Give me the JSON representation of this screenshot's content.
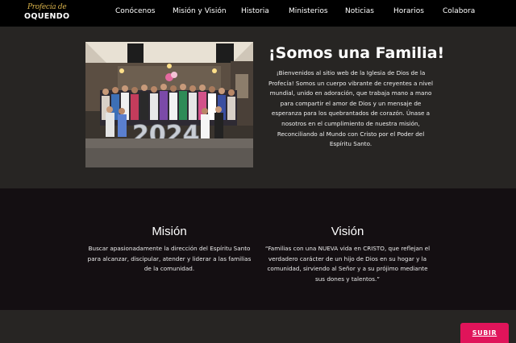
{
  "logo": {
    "script_text": "Profecía de",
    "main_text": "OQUENDO"
  },
  "nav": {
    "items": [
      {
        "label": "Conócenos"
      },
      {
        "label": "Misión y Visión"
      },
      {
        "label": "Historia"
      },
      {
        "label": "Ministerios"
      },
      {
        "label": "Noticias"
      },
      {
        "label": "Horarios"
      },
      {
        "label": "Colabora"
      }
    ]
  },
  "hero": {
    "title": "¡Somos una Familia!",
    "body": "¡Bienvenidos al sitio web de la Iglesia de Dios de la Profecía! Somos un cuerpo vibrante de creyentes a nivel mundial, unido en adoración, que trabaja mano a mano para compartir el amor de Dios y un mensaje de esperanza para los quebrantados de corazón. Únase a nosotros en el cumplimiento de nuestra misión, Reconciliando al Mundo con Cristo por el Poder del Espíritu Santo.",
    "photo_balloons": "2024"
  },
  "mision": {
    "title": "Misión",
    "text": "Buscar apasionadamente la dirección del Espíritu Santo para alcanzar, discipular, atender y liderar a las familias de la comunidad."
  },
  "vision": {
    "title": "Visión",
    "text": "“Familias con una NUEVA vida en CRISTO, que reflejan el verdadero carácter de un hijo de Dios en su hogar y la comunidad, sirviendo al Señor y a su prójimo mediante sus dones y talentos.”"
  },
  "scroll_top": {
    "label": "SUBIR"
  },
  "colors": {
    "nav_bg": "#000000",
    "hero_bg": "#272523",
    "mission_bg": "#140f12",
    "accent": "#e0145a",
    "logo_gold": "#d6b04a"
  }
}
